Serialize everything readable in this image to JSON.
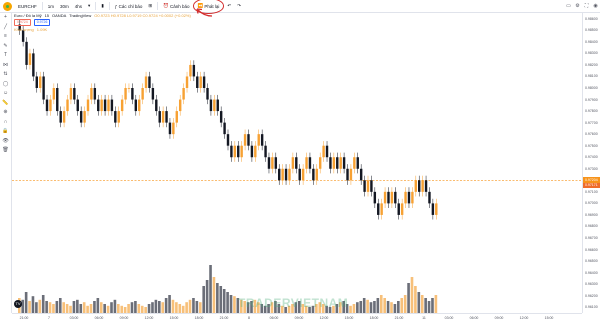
{
  "toolbar": {
    "symbol": "EURCHF",
    "items": [
      "1m",
      "30m",
      "4hs",
      "15"
    ],
    "indicators_label": "Các chỉ báo",
    "alert_label": "Cảnh báo",
    "replay_label": "Phát lại",
    "right_label": "Lưu",
    "undo_label": "Hoàn tác"
  },
  "legend": {
    "title": "Euro / Đô la Mỹ",
    "interval": "15",
    "exchange": "OANDA",
    "source": "TradingView",
    "ohlc": "O0.9723 H0.9728 L0.9719 C0.9724 +0.0002 (+0.02%)",
    "sell_btn": "0.9724",
    "buy_btn": "0.9726",
    "volume_label": "Khối lượng",
    "volume_value": "1.09K"
  },
  "price_axis": {
    "ticks": [
      "0.98600",
      "0.98500",
      "0.98400",
      "0.98300",
      "0.98200",
      "0.98100",
      "0.98000",
      "0.97900",
      "0.97800",
      "0.97700",
      "0.97600",
      "0.97500",
      "0.97400",
      "0.97300",
      "0.97200",
      "0.97100",
      "0.97000",
      "0.96900",
      "0.96800",
      "0.96700",
      "0.96600",
      "0.96500",
      "0.96400",
      "0.96300",
      "0.96200",
      "0.96100"
    ],
    "current": "0.97204",
    "current2": "0.97171"
  },
  "time_axis": {
    "labels": [
      "21:00",
      "7",
      "03:00",
      "06:00",
      "09:00",
      "12:00",
      "15:00",
      "18:00",
      "21:00",
      "8",
      "06:00",
      "09:00",
      "12:00",
      "15:00",
      "18:00",
      "21:00",
      "11",
      "03:00",
      "06:00",
      "09:00",
      "12:00",
      "15:00"
    ]
  },
  "watermark": "TRADERVIETNAM",
  "colors": {
    "up": "#f7a133",
    "down": "#131722",
    "highlight": "#d32f2f",
    "current_line": "#f7931a"
  },
  "chart_data": {
    "type": "candlestick",
    "description_series": "EURCHF 15m closing prices (approx.)",
    "close": [
      0.985,
      0.984,
      0.982,
      0.983,
      0.981,
      0.98,
      0.981,
      0.979,
      0.978,
      0.979,
      0.98,
      0.978,
      0.977,
      0.978,
      0.979,
      0.98,
      0.979,
      0.978,
      0.977,
      0.978,
      0.979,
      0.98,
      0.979,
      0.978,
      0.979,
      0.978,
      0.979,
      0.978,
      0.977,
      0.978,
      0.979,
      0.98,
      0.98,
      0.979,
      0.978,
      0.979,
      0.98,
      0.981,
      0.98,
      0.979,
      0.978,
      0.977,
      0.978,
      0.977,
      0.976,
      0.977,
      0.978,
      0.979,
      0.98,
      0.981,
      0.982,
      0.981,
      0.98,
      0.981,
      0.98,
      0.979,
      0.978,
      0.979,
      0.978,
      0.977,
      0.976,
      0.975,
      0.974,
      0.975,
      0.974,
      0.975,
      0.976,
      0.975,
      0.974,
      0.975,
      0.976,
      0.975,
      0.974,
      0.973,
      0.974,
      0.973,
      0.972,
      0.973,
      0.972,
      0.973,
      0.974,
      0.973,
      0.972,
      0.973,
      0.974,
      0.973,
      0.972,
      0.973,
      0.974,
      0.975,
      0.974,
      0.973,
      0.974,
      0.973,
      0.974,
      0.973,
      0.972,
      0.973,
      0.974,
      0.973,
      0.972,
      0.971,
      0.972,
      0.971,
      0.97,
      0.969,
      0.97,
      0.971,
      0.97,
      0.971,
      0.97,
      0.969,
      0.97,
      0.971,
      0.97,
      0.971,
      0.972,
      0.971,
      0.972,
      0.971,
      0.97,
      0.969,
      0.97
    ],
    "volume": [
      0.25,
      0.22,
      0.35,
      0.2,
      0.28,
      0.18,
      0.22,
      0.3,
      0.2,
      0.18,
      0.15,
      0.2,
      0.25,
      0.18,
      0.15,
      0.12,
      0.2,
      0.22,
      0.15,
      0.18,
      0.12,
      0.15,
      0.2,
      0.25,
      0.18,
      0.15,
      0.12,
      0.18,
      0.22,
      0.15,
      0.12,
      0.1,
      0.15,
      0.18,
      0.2,
      0.15,
      0.12,
      0.1,
      0.15,
      0.18,
      0.22,
      0.2,
      0.18,
      0.25,
      0.3,
      0.22,
      0.18,
      0.15,
      0.12,
      0.18,
      0.22,
      0.25,
      0.2,
      0.18,
      0.45,
      0.55,
      0.8,
      0.6,
      0.5,
      0.45,
      0.4,
      0.35,
      0.3,
      0.28,
      0.25,
      0.22,
      0.2,
      0.18,
      0.2,
      0.22,
      0.18,
      0.15,
      0.12,
      0.15,
      0.18,
      0.2,
      0.15,
      0.12,
      0.1,
      0.12,
      0.15,
      0.18,
      0.2,
      0.15,
      0.12,
      0.1,
      0.12,
      0.15,
      0.18,
      0.15,
      0.12,
      0.1,
      0.12,
      0.15,
      0.18,
      0.2,
      0.15,
      0.12,
      0.15,
      0.18,
      0.2,
      0.25,
      0.22,
      0.18,
      0.2,
      0.25,
      0.3,
      0.25,
      0.2,
      0.18,
      0.15,
      0.2,
      0.25,
      0.3,
      0.5,
      0.6,
      0.45,
      0.35,
      0.3,
      0.25,
      0.2,
      0.25,
      0.3
    ]
  }
}
